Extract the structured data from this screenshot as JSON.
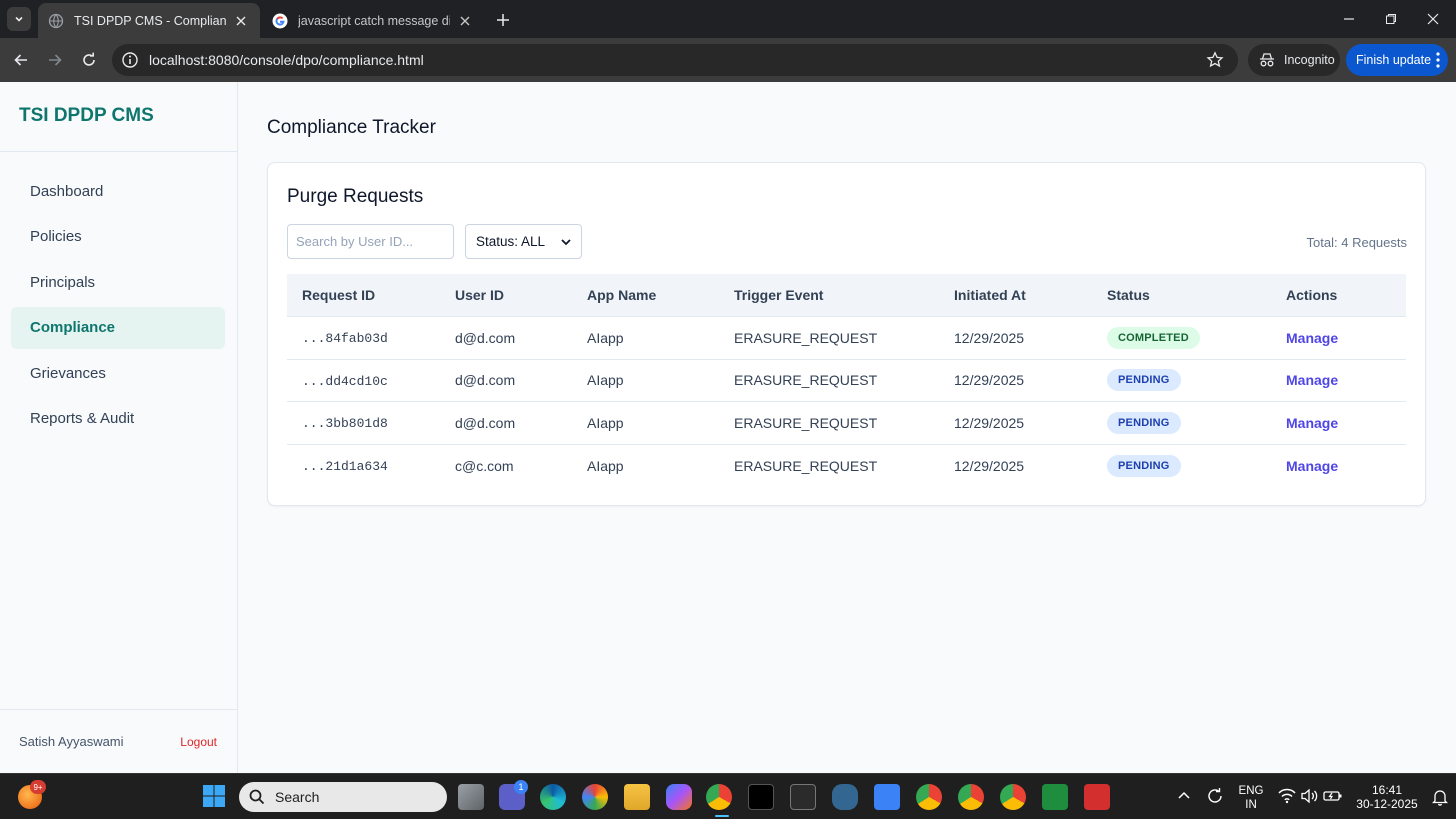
{
  "browser": {
    "tabs": [
      {
        "title": "TSI DPDP CMS - Compliance M",
        "active": true
      },
      {
        "title": "javascript catch message displa",
        "active": false
      }
    ],
    "url": "localhost:8080/console/dpo/compliance.html",
    "incognito_label": "Incognito",
    "update_label": "Finish update"
  },
  "sidebar": {
    "brand": "TSI DPDP CMS",
    "items": [
      {
        "label": "Dashboard",
        "active": false
      },
      {
        "label": "Policies",
        "active": false
      },
      {
        "label": "Principals",
        "active": false
      },
      {
        "label": "Compliance",
        "active": true
      },
      {
        "label": "Grievances",
        "active": false
      },
      {
        "label": "Reports & Audit",
        "active": false
      }
    ],
    "user_name": "Satish Ayyaswami",
    "logout_label": "Logout"
  },
  "main": {
    "page_title": "Compliance Tracker",
    "card_title": "Purge Requests",
    "search": {
      "placeholder": "Search by User ID...",
      "value": ""
    },
    "status_filter": "Status: ALL",
    "total": "Total: 4 Requests",
    "columns": [
      "Request ID",
      "User ID",
      "App Name",
      "Trigger Event",
      "Initiated At",
      "Status",
      "Actions"
    ],
    "rows": [
      {
        "request_id": "...84fab03d",
        "user_id": "d@d.com",
        "app": "AIapp",
        "trigger": "ERASURE_REQUEST",
        "initiated": "12/29/2025",
        "status": "COMPLETED",
        "action": "Manage"
      },
      {
        "request_id": "...dd4cd10c",
        "user_id": "d@d.com",
        "app": "AIapp",
        "trigger": "ERASURE_REQUEST",
        "initiated": "12/29/2025",
        "status": "PENDING",
        "action": "Manage"
      },
      {
        "request_id": "...3bb801d8",
        "user_id": "d@d.com",
        "app": "AIapp",
        "trigger": "ERASURE_REQUEST",
        "initiated": "12/29/2025",
        "status": "PENDING",
        "action": "Manage"
      },
      {
        "request_id": "...21d1a634",
        "user_id": "c@c.com",
        "app": "AIapp",
        "trigger": "ERASURE_REQUEST",
        "initiated": "12/29/2025",
        "status": "PENDING",
        "action": "Manage"
      }
    ],
    "colors": {
      "accent": "#0f766e",
      "link": "#4f46e5",
      "completed_bg": "#dcfce7",
      "pending_bg": "#dbeafe"
    }
  },
  "taskbar": {
    "search_label": "Search",
    "widget_badge": "9+",
    "teams_badge": "1",
    "lang_line1": "ENG",
    "lang_line2": "IN",
    "time": "16:41",
    "date": "30-12-2025"
  }
}
